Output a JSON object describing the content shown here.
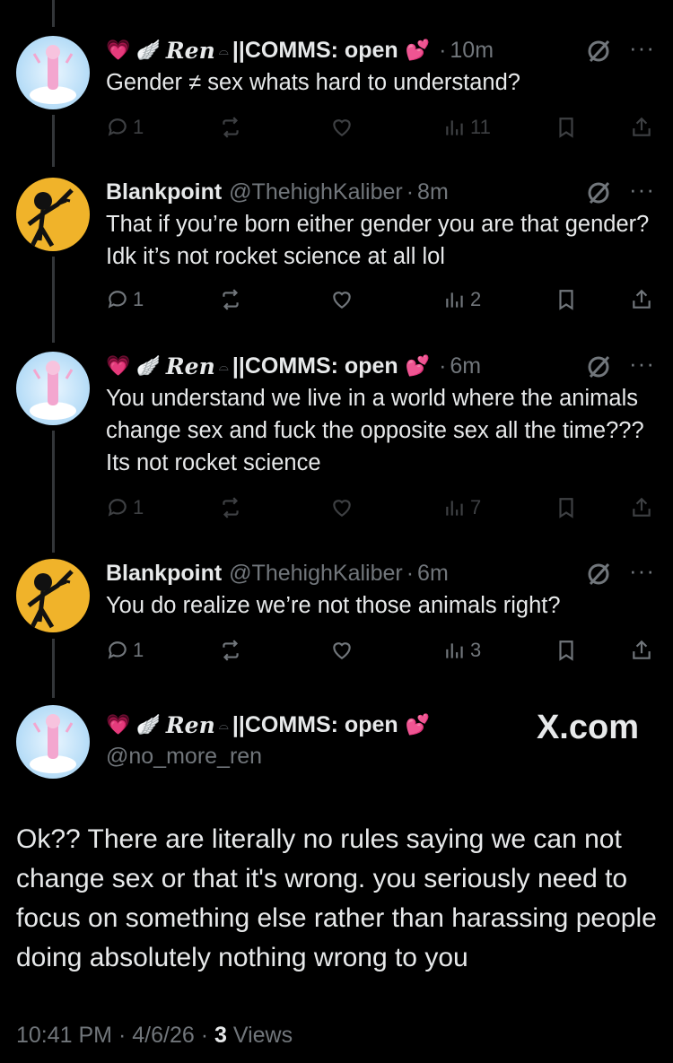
{
  "tweets": [
    {
      "name_prefix": "💗 🪽",
      "name_fancy": "Ren",
      "name_bow": "⌓",
      "name_main": "||COMMS: open",
      "name_suffix": "💕",
      "handle": "",
      "time": "10m",
      "text": "Gender ≠ sex whats hard to understand?",
      "replies": "1",
      "views": "11"
    },
    {
      "name_main": "Blankpoint",
      "handle": "@ThehighKaliber",
      "time": "8m",
      "text": "That if you’re born either gender you are that gender? Idk it’s not rocket science at all lol",
      "replies": "1",
      "views": "2"
    },
    {
      "name_prefix": "💗 🪽",
      "name_fancy": "Ren",
      "name_bow": "⌓",
      "name_main": "||COMMS: open",
      "name_suffix": "💕",
      "handle": "",
      "time": "6m",
      "text": "You understand we live in a world where the animals change sex and fuck the opposite sex all the time??? Its not rocket science",
      "replies": "1",
      "views": "7"
    },
    {
      "name_main": "Blankpoint",
      "handle": "@ThehighKaliber",
      "time": "6m",
      "text": "You do realize we’re not those animals right?",
      "replies": "1",
      "views": "3"
    }
  ],
  "main_tweet": {
    "name_prefix": "💗 🪽",
    "name_fancy": "Ren",
    "name_bow": "⌓",
    "name_main": "||COMMS: open",
    "name_suffix": "💕",
    "handle": "@no_more_ren",
    "watermark": "X.com",
    "text": "Ok?? There are literally no rules saying we can not change sex or that it's wrong. you seriously need to focus on something else rather than harassing people doing absolutely nothing wrong to you",
    "time": "10:41 PM",
    "date": "4/6/26",
    "views_count": "3",
    "views_label": "Views"
  },
  "colors": {
    "background": "#000000",
    "text": "#e7e9ea",
    "muted": "#71767b",
    "thread_line": "#333639"
  },
  "icons": [
    "reply-icon",
    "retweet-icon",
    "like-icon",
    "views-icon",
    "bookmark-icon",
    "share-icon",
    "grok-icon",
    "more-icon"
  ]
}
